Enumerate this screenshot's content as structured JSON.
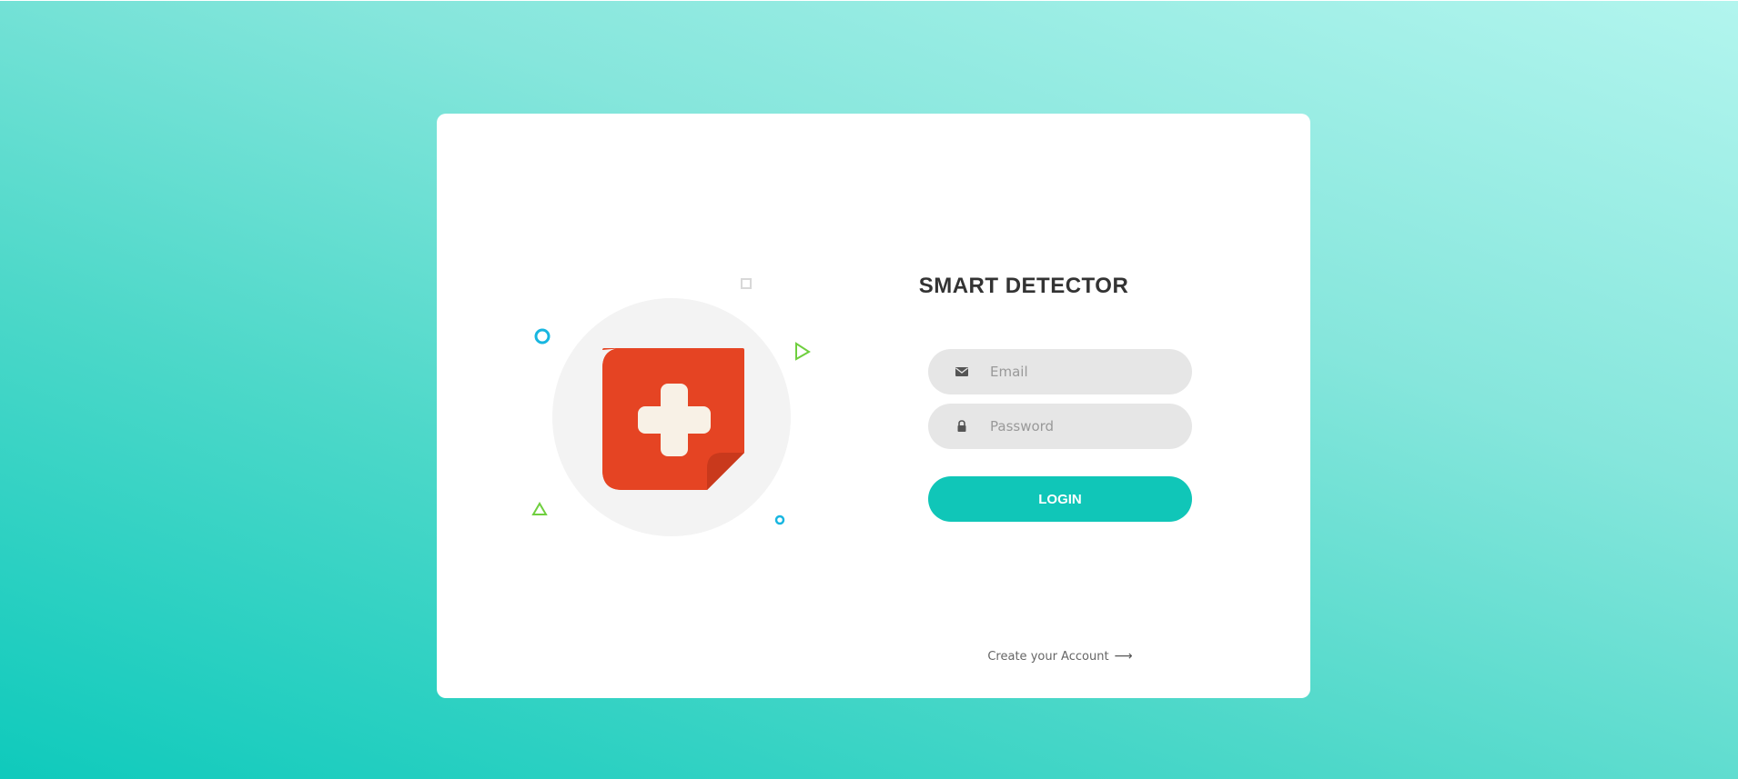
{
  "login_form": {
    "title": "SMART DETECTOR",
    "email": {
      "placeholder": "Email",
      "value": "",
      "icon": "envelope-icon"
    },
    "password": {
      "placeholder": "Password",
      "value": "",
      "icon": "lock-icon"
    },
    "login_label": "Login",
    "create_account_label": "Create your Account",
    "create_account_arrow": "⟶"
  },
  "illustration": {
    "icon": "medical-plus-note-icon"
  },
  "colors": {
    "background_gradient_start": "#0fcabc",
    "background_gradient_end": "#b2f5ee",
    "accent": "#10c6b8",
    "note_red": "#e54423",
    "plus_cream": "#f8f1e6",
    "input_bg": "#e6e6e6",
    "deco_blue": "#18b6e0",
    "deco_green": "#6fcf3f"
  }
}
